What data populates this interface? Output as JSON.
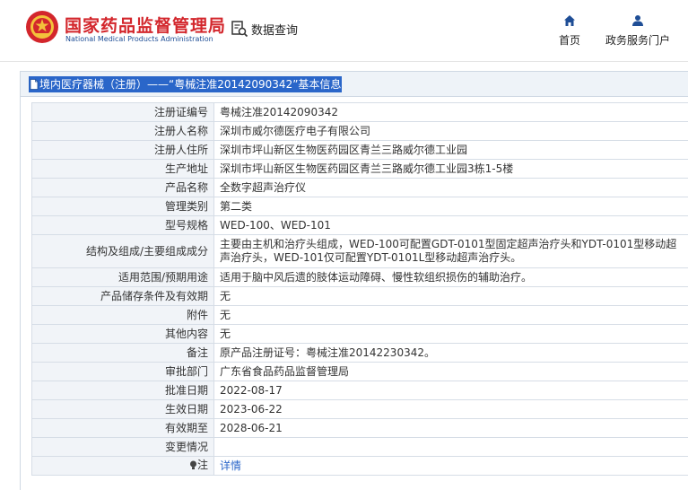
{
  "header": {
    "org_cn": "国家药品监督管理局",
    "org_en": "National Medical Products Administration",
    "query_label": "数据查询",
    "nav": {
      "home_label": "首页",
      "service_label": "政务服务门户"
    }
  },
  "panel": {
    "title": "境内医疗器械（注册）——“粤械注准20142090342”基本信息"
  },
  "rows": [
    {
      "label": "注册证编号",
      "value": "粤械注准20142090342"
    },
    {
      "label": "注册人名称",
      "value": "深圳市威尔德医疗电子有限公司"
    },
    {
      "label": "注册人住所",
      "value": "深圳市坪山新区生物医药园区青兰三路威尔德工业园"
    },
    {
      "label": "生产地址",
      "value": "深圳市坪山新区生物医药园区青兰三路威尔德工业园3栋1-5楼"
    },
    {
      "label": "产品名称",
      "value": "全数字超声治疗仪"
    },
    {
      "label": "管理类别",
      "value": "第二类"
    },
    {
      "label": "型号规格",
      "value": "WED-100、WED-101"
    },
    {
      "label": "结构及组成/主要组成成分",
      "value": "主要由主机和治疗头组成，WED-100可配置GDT-0101型固定超声治疗头和YDT-0101型移动超声治疗头，WED-101仅可配置YDT-0101L型移动超声治疗头。"
    },
    {
      "label": "适用范围/预期用途",
      "value": "适用于脑中风后遗的肢体运动障碍、慢性软组织损伤的辅助治疗。"
    },
    {
      "label": "产品储存条件及有效期",
      "value": "无"
    },
    {
      "label": "附件",
      "value": "无"
    },
    {
      "label": "其他内容",
      "value": "无"
    },
    {
      "label": "备注",
      "value": "原产品注册证号：粤械注准20142230342。"
    },
    {
      "label": "审批部门",
      "value": "广东省食品药品监督管理局"
    },
    {
      "label": "批准日期",
      "value": "2022-08-17"
    },
    {
      "label": "生效日期",
      "value": "2023-06-22"
    },
    {
      "label": "有效期至",
      "value": "2028-06-21"
    },
    {
      "label": "变更情况",
      "value": ""
    }
  ],
  "note_row": {
    "label": "注",
    "link_text": "详情"
  },
  "colors": {
    "brand_red": "#d3262c",
    "brand_blue": "#1f4e96",
    "highlight_blue": "#2a66c9"
  }
}
